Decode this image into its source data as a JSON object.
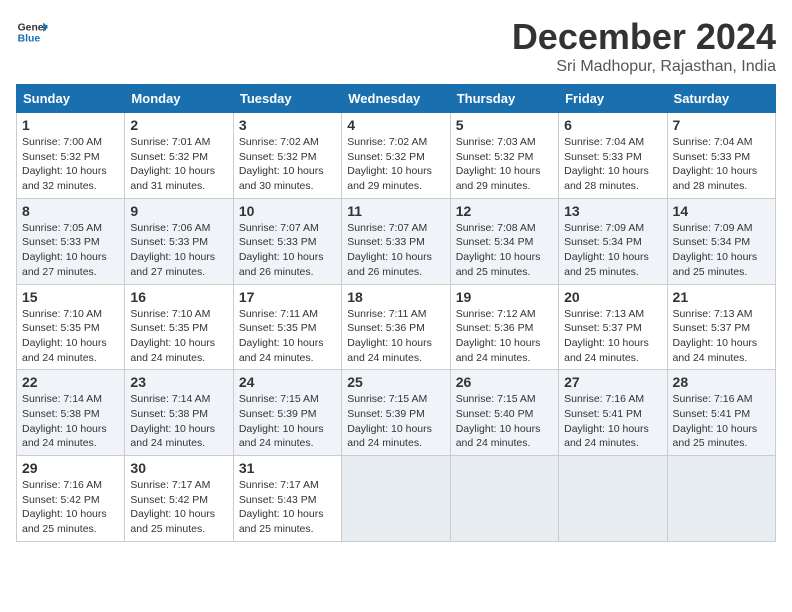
{
  "logo": {
    "line1": "General",
    "line2": "Blue"
  },
  "title": "December 2024",
  "subtitle": "Sri Madhopur, Rajasthan, India",
  "weekdays": [
    "Sunday",
    "Monday",
    "Tuesday",
    "Wednesday",
    "Thursday",
    "Friday",
    "Saturday"
  ],
  "weeks": [
    [
      {
        "day": "1",
        "sunrise": "7:00 AM",
        "sunset": "5:32 PM",
        "daylight": "10 hours and 32 minutes."
      },
      {
        "day": "2",
        "sunrise": "7:01 AM",
        "sunset": "5:32 PM",
        "daylight": "10 hours and 31 minutes."
      },
      {
        "day": "3",
        "sunrise": "7:02 AM",
        "sunset": "5:32 PM",
        "daylight": "10 hours and 30 minutes."
      },
      {
        "day": "4",
        "sunrise": "7:02 AM",
        "sunset": "5:32 PM",
        "daylight": "10 hours and 29 minutes."
      },
      {
        "day": "5",
        "sunrise": "7:03 AM",
        "sunset": "5:32 PM",
        "daylight": "10 hours and 29 minutes."
      },
      {
        "day": "6",
        "sunrise": "7:04 AM",
        "sunset": "5:33 PM",
        "daylight": "10 hours and 28 minutes."
      },
      {
        "day": "7",
        "sunrise": "7:04 AM",
        "sunset": "5:33 PM",
        "daylight": "10 hours and 28 minutes."
      }
    ],
    [
      {
        "day": "8",
        "sunrise": "7:05 AM",
        "sunset": "5:33 PM",
        "daylight": "10 hours and 27 minutes."
      },
      {
        "day": "9",
        "sunrise": "7:06 AM",
        "sunset": "5:33 PM",
        "daylight": "10 hours and 27 minutes."
      },
      {
        "day": "10",
        "sunrise": "7:07 AM",
        "sunset": "5:33 PM",
        "daylight": "10 hours and 26 minutes."
      },
      {
        "day": "11",
        "sunrise": "7:07 AM",
        "sunset": "5:33 PM",
        "daylight": "10 hours and 26 minutes."
      },
      {
        "day": "12",
        "sunrise": "7:08 AM",
        "sunset": "5:34 PM",
        "daylight": "10 hours and 25 minutes."
      },
      {
        "day": "13",
        "sunrise": "7:09 AM",
        "sunset": "5:34 PM",
        "daylight": "10 hours and 25 minutes."
      },
      {
        "day": "14",
        "sunrise": "7:09 AM",
        "sunset": "5:34 PM",
        "daylight": "10 hours and 25 minutes."
      }
    ],
    [
      {
        "day": "15",
        "sunrise": "7:10 AM",
        "sunset": "5:35 PM",
        "daylight": "10 hours and 24 minutes."
      },
      {
        "day": "16",
        "sunrise": "7:10 AM",
        "sunset": "5:35 PM",
        "daylight": "10 hours and 24 minutes."
      },
      {
        "day": "17",
        "sunrise": "7:11 AM",
        "sunset": "5:35 PM",
        "daylight": "10 hours and 24 minutes."
      },
      {
        "day": "18",
        "sunrise": "7:11 AM",
        "sunset": "5:36 PM",
        "daylight": "10 hours and 24 minutes."
      },
      {
        "day": "19",
        "sunrise": "7:12 AM",
        "sunset": "5:36 PM",
        "daylight": "10 hours and 24 minutes."
      },
      {
        "day": "20",
        "sunrise": "7:13 AM",
        "sunset": "5:37 PM",
        "daylight": "10 hours and 24 minutes."
      },
      {
        "day": "21",
        "sunrise": "7:13 AM",
        "sunset": "5:37 PM",
        "daylight": "10 hours and 24 minutes."
      }
    ],
    [
      {
        "day": "22",
        "sunrise": "7:14 AM",
        "sunset": "5:38 PM",
        "daylight": "10 hours and 24 minutes."
      },
      {
        "day": "23",
        "sunrise": "7:14 AM",
        "sunset": "5:38 PM",
        "daylight": "10 hours and 24 minutes."
      },
      {
        "day": "24",
        "sunrise": "7:15 AM",
        "sunset": "5:39 PM",
        "daylight": "10 hours and 24 minutes."
      },
      {
        "day": "25",
        "sunrise": "7:15 AM",
        "sunset": "5:39 PM",
        "daylight": "10 hours and 24 minutes."
      },
      {
        "day": "26",
        "sunrise": "7:15 AM",
        "sunset": "5:40 PM",
        "daylight": "10 hours and 24 minutes."
      },
      {
        "day": "27",
        "sunrise": "7:16 AM",
        "sunset": "5:41 PM",
        "daylight": "10 hours and 24 minutes."
      },
      {
        "day": "28",
        "sunrise": "7:16 AM",
        "sunset": "5:41 PM",
        "daylight": "10 hours and 25 minutes."
      }
    ],
    [
      {
        "day": "29",
        "sunrise": "7:16 AM",
        "sunset": "5:42 PM",
        "daylight": "10 hours and 25 minutes."
      },
      {
        "day": "30",
        "sunrise": "7:17 AM",
        "sunset": "5:42 PM",
        "daylight": "10 hours and 25 minutes."
      },
      {
        "day": "31",
        "sunrise": "7:17 AM",
        "sunset": "5:43 PM",
        "daylight": "10 hours and 25 minutes."
      },
      null,
      null,
      null,
      null
    ]
  ],
  "labels": {
    "sunrise": "Sunrise:",
    "sunset": "Sunset:",
    "daylight": "Daylight:"
  }
}
